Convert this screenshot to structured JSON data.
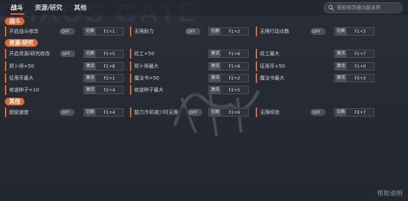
{
  "background_text": "CHAOS GATE",
  "tabs": [
    "战斗",
    "资源/研究",
    "其他"
  ],
  "search": {
    "placeholder": "搜索修改器功能名称"
  },
  "sections": {
    "battle": "战斗",
    "resources": "资源/研究",
    "other": "其他"
  },
  "rows": {
    "r1": [
      {
        "label": "开启战斗修改",
        "toggle": "OFF",
        "action": "切换",
        "key": "F1+1"
      },
      {
        "label": "无限耐力",
        "toggle": "OFF",
        "action": "切换",
        "key": "F1+2"
      },
      {
        "label": "无限行动点数",
        "toggle": "OFF",
        "action": "切换",
        "key": "F1+3"
      }
    ],
    "r2": [
      {
        "label": "开启资源/研究修改",
        "toggle": "OFF",
        "action": "切换",
        "key": "F1+5"
      },
      {
        "label": "纹工+50",
        "action": "激活",
        "key": "F1+6"
      },
      {
        "label": "纹工最大",
        "action": "激活",
        "key": "F1+7"
      }
    ],
    "r3": [
      {
        "label": "预卜师+50",
        "action": "激活",
        "key": "F1+8"
      },
      {
        "label": "预卜师最大",
        "action": "激活",
        "key": "F1+9"
      },
      {
        "label": "征用币+50",
        "action": "激活",
        "key": "F1+0"
      }
    ],
    "r4": [
      {
        "label": "征用币最大",
        "action": "激活",
        "key": "F2+1"
      },
      {
        "label": "魔法书+50",
        "action": "激活",
        "key": "F2+2"
      },
      {
        "label": "魔法书最大",
        "action": "激活",
        "key": "F2+3"
      }
    ],
    "r5": [
      {
        "label": "修道种子+10",
        "action": "激活",
        "key": "F2+4"
      },
      {
        "label": "修道种子最大",
        "action": "激活",
        "key": "F2+5"
      }
    ],
    "r6": [
      {
        "label": "超级速度",
        "toggle": "OFF",
        "action": "切换",
        "key": "F1+4"
      },
      {
        "label": "能力冷却减少时无限",
        "toggle": "OFF",
        "action": "切换",
        "key": "F2+6"
      },
      {
        "label": "无限经验",
        "toggle": "OFF",
        "action": "切换",
        "key": "F2+7"
      }
    ]
  },
  "help": "帮助说明",
  "colors": {
    "accent": "#e5672e",
    "background": "#262b33"
  }
}
